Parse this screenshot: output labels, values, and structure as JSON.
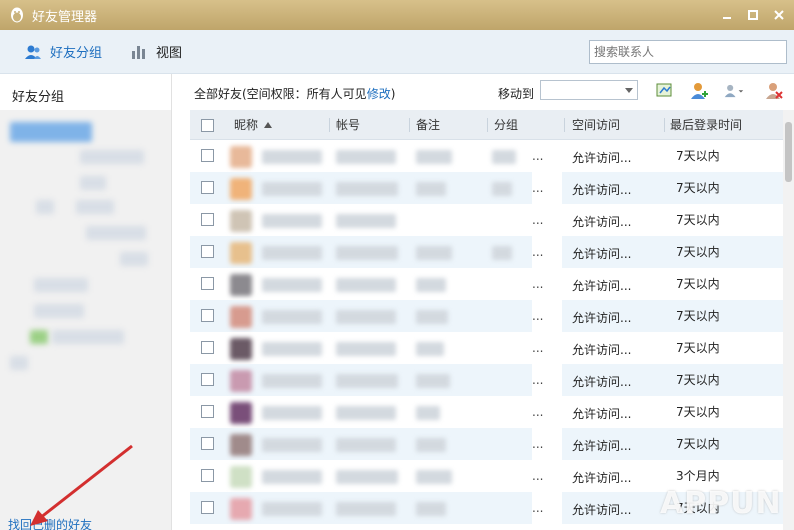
{
  "window": {
    "title": "好友管理器"
  },
  "toolbar": {
    "tabs": [
      {
        "label": "好友分组"
      },
      {
        "label": "视图"
      }
    ],
    "search_placeholder": "搜索联系人"
  },
  "sidebar": {
    "header": "好友分组",
    "recover_link": "找回已删的好友"
  },
  "main": {
    "all_friends_label": "全部好友(空间权限：所有人可见",
    "edit_link": "修改",
    "close_paren": ")",
    "move_to_label": "移动到"
  },
  "table": {
    "columns": [
      "昵称",
      "帐号",
      "备注",
      "分组",
      "空间访问",
      "最后登录时间"
    ],
    "rows": [
      {
        "access": "允许访问...",
        "last_login": "7天以内"
      },
      {
        "access": "允许访问...",
        "last_login": "7天以内"
      },
      {
        "access": "允许访问...",
        "last_login": "7天以内"
      },
      {
        "access": "允许访问...",
        "last_login": "7天以内"
      },
      {
        "access": "允许访问...",
        "last_login": "7天以内"
      },
      {
        "access": "允许访问...",
        "last_login": "7天以内"
      },
      {
        "access": "允许访问...",
        "last_login": "7天以内"
      },
      {
        "access": "允许访问...",
        "last_login": "7天以内"
      },
      {
        "access": "允许访问...",
        "last_login": "7天以内"
      },
      {
        "access": "允许访问...",
        "last_login": "7天以内"
      },
      {
        "access": "允许访问...",
        "last_login": "3个月内"
      },
      {
        "access": "允许访问...",
        "last_login": "7天以内"
      }
    ]
  },
  "watermark": "APPUN",
  "colors": {
    "titlebar": "#c9b27a",
    "accent": "#1e6fbf",
    "arrow": "#d32f2f"
  }
}
